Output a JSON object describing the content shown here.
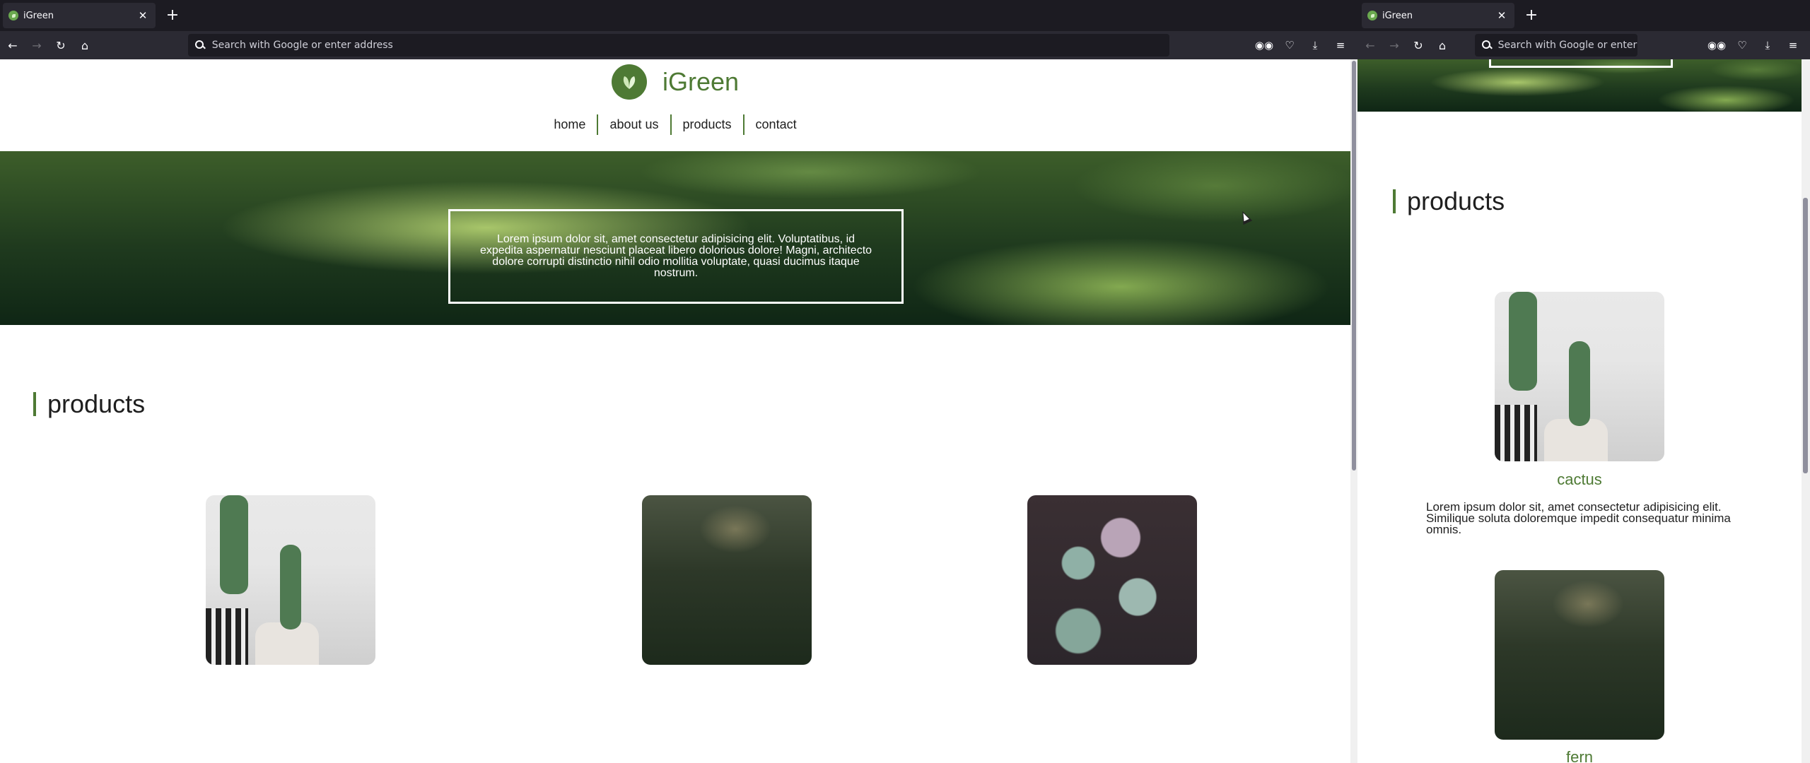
{
  "colors": {
    "brand_green": "#4e7a34",
    "chrome_dark": "#1c1b22",
    "chrome_toolbar": "#2b2a33"
  },
  "left_window": {
    "tab": {
      "title": "iGreen",
      "close_icon": "close-icon"
    },
    "urlbar": {
      "placeholder": "Search with Google or enter address"
    },
    "site": {
      "logo_title": "iGreen",
      "nav": [
        "home",
        "about us",
        "products",
        "contact"
      ],
      "hero_text": "Lorem ipsum dolor sit, amet consectetur adipisicing elit. Voluptatibus, id expedita aspernatur nesciunt placeat libero dolorious dolore! Magni, architecto dolore corrupti distinctio nihil odio mollitia voluptate, quasi ducimus itaque nostrum.",
      "section_title": "products"
    }
  },
  "right_window": {
    "tab": {
      "title": "iGreen"
    },
    "urlbar": {
      "placeholder": "Search with Google or enter address"
    },
    "site": {
      "section_title": "products",
      "products": [
        {
          "name": "cactus",
          "description": "Lorem ipsum dolor sit, amet consectetur adipisicing elit. Similique soluta doloremque impedit consequatur minima omnis."
        },
        {
          "name": "fern"
        }
      ]
    }
  }
}
